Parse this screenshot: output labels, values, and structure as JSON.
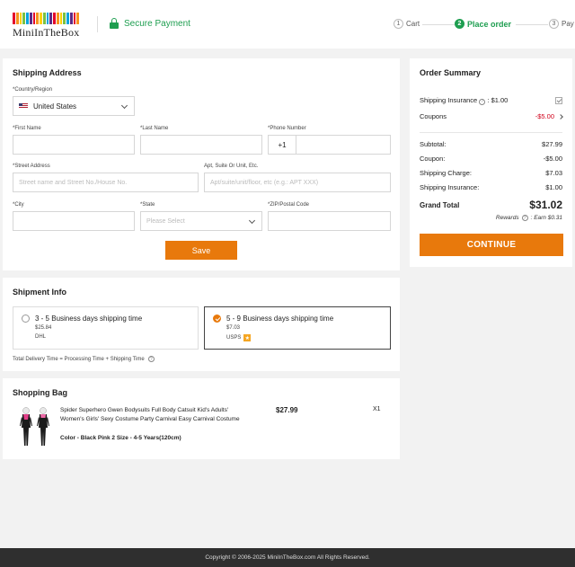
{
  "header": {
    "logo_text": "MiniInTheBox",
    "logo_colors": [
      "#e4002b",
      "#f7941d",
      "#ffd100",
      "#7ac143",
      "#00a3e0",
      "#5b2c86",
      "#e4002b",
      "#f7941d",
      "#ffd100",
      "#7ac143",
      "#00a3e0",
      "#5b2c86",
      "#e4002b",
      "#f7941d",
      "#ffd100",
      "#7ac143",
      "#00a3e0",
      "#5b2c86",
      "#e4002b",
      "#f7941d"
    ],
    "secure_label": "Secure Payment",
    "steps": [
      {
        "num": "1",
        "label": "Cart"
      },
      {
        "num": "2",
        "label": "Place order"
      },
      {
        "num": "3",
        "label": "Pay"
      }
    ]
  },
  "shipping_address": {
    "title": "Shipping Address",
    "country_label": "*Country/Region",
    "country_value": "United States",
    "first_name_label": "*First Name",
    "last_name_label": "*Last Name",
    "phone_label": "*Phone Number",
    "phone_code": "+1",
    "street_label": "*Street Address",
    "street_placeholder": "Street name and Street No./House No.",
    "apt_label": "Apt, Suite Or Unit, Etc.",
    "apt_placeholder": "Apt/suite/unit/floor, etc (e.g.: APT XXX)",
    "city_label": "*City",
    "state_label": "*State",
    "state_placeholder": "Please Select",
    "zip_label": "*ZIP/Postal Code",
    "save_label": "Save"
  },
  "shipment": {
    "title": "Shipment Info",
    "options": [
      {
        "title": "3 - 5 Business days shipping time",
        "price": "$25.84",
        "carrier": "DHL"
      },
      {
        "title": "5 - 9 Business days shipping time",
        "price": "$7.03",
        "carrier": "USPS",
        "badge": "★"
      }
    ],
    "note": "Total Delivery Time = Processing Time + Shipping Time"
  },
  "bag": {
    "title": "Shopping Bag",
    "item": {
      "name": "Spider Superhero Gwen Bodysuits Full Body Catsuit Kid's Adults' Women's Girls' Sexy Costume Party Carnival Easy Carnival Costume",
      "attrs": "Color - Black Pink 2  Size - 4-5 Years(120cm)",
      "price": "$27.99",
      "qty": "X1"
    }
  },
  "summary": {
    "title": "Order Summary",
    "insurance_label": "Shipping Insurance",
    "insurance_price": ": $1.00",
    "coupons_label": "Coupons",
    "coupons_value": "-$5.00",
    "subtotal_label": "Subtotal:",
    "subtotal_value": "$27.99",
    "coupon_label": "Coupon:",
    "coupon_value": "-$5.00",
    "charge_label": "Shipping Charge:",
    "charge_value": "$7.03",
    "insurance2_label": "Shipping Insurance:",
    "insurance2_value": "$1.00",
    "grand_label": "Grand Total",
    "grand_value": "$31.02",
    "rewards_label": "Rewards",
    "rewards_value": ": Earn $0.31",
    "continue_label": "CONTINUE"
  },
  "footer": {
    "copyright": "Copyright © 2006-2025 MiniInTheBox.com All Rights Reserved."
  }
}
